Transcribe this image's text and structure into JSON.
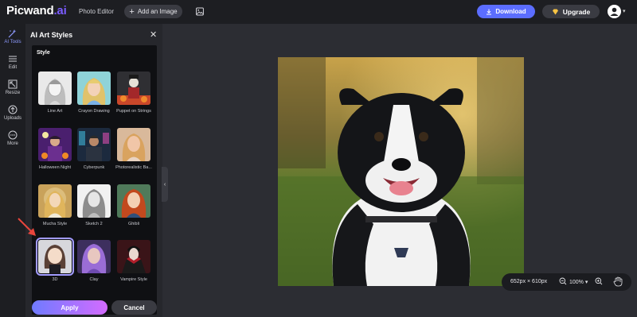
{
  "header": {
    "logo_main": "Picwand",
    "logo_suffix": ".ai",
    "nav_photo_editor": "Photo Editor",
    "add_image": "Add an Image",
    "download": "Download",
    "upgrade": "Upgrade"
  },
  "rail": [
    {
      "label": "AI Tools",
      "icon": "ai-tools-icon"
    },
    {
      "label": "Edit",
      "icon": "menu-icon"
    },
    {
      "label": "Resize",
      "icon": "resize-icon"
    },
    {
      "label": "Uploads",
      "icon": "upload-icon"
    },
    {
      "label": "More",
      "icon": "more-icon"
    }
  ],
  "panel": {
    "title": "AI Art Styles",
    "section_label": "Style",
    "styles": [
      {
        "label": "Line Art"
      },
      {
        "label": "Crayon Drawing"
      },
      {
        "label": "Puppet on Strings"
      },
      {
        "label": "Halloween Night"
      },
      {
        "label": "Cyberpunk"
      },
      {
        "label": "Photorealistic Ba..."
      },
      {
        "label": "Mucha Style"
      },
      {
        "label": "Sketch 2"
      },
      {
        "label": "Ghibli"
      },
      {
        "label": "3D"
      },
      {
        "label": "Clay"
      },
      {
        "label": "Vampire Style"
      }
    ],
    "selected_style": "3D",
    "apply": "Apply",
    "cancel": "Cancel"
  },
  "canvas": {
    "dimensions": "652px × 610px",
    "zoom": "100%"
  },
  "colors": {
    "accent": "#5b6dff",
    "selection": "#a29bff",
    "apply_gradient_start": "#6f7bff",
    "apply_gradient_end": "#d46bff",
    "arrow": "#e8453c"
  }
}
